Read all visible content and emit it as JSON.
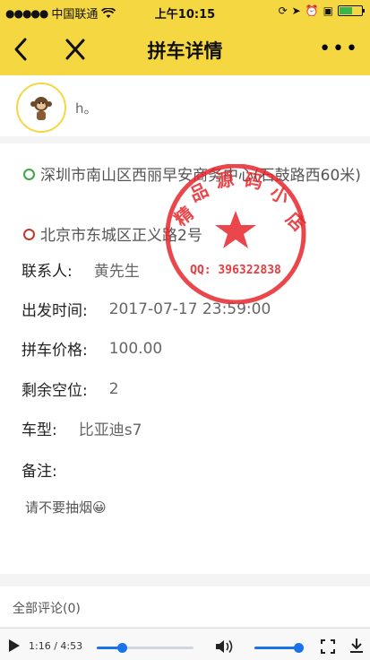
{
  "status_bar": {
    "carrier": "中国联通",
    "time": "上午10:15"
  },
  "nav": {
    "title": "拼车详情",
    "more": "•••"
  },
  "user": {
    "name": "h。"
  },
  "route": {
    "from": "深圳市南山区西丽早安商务中心(石鼓路西60米)",
    "to": "北京市东城区正义路2号",
    "from_color": "#3aa845",
    "to_color": "#c0392b"
  },
  "fields": {
    "contact_label": "联系人:",
    "contact_value": "黄先生",
    "depart_label": "出发时间:",
    "depart_value": "2017-07-17 23:59:00",
    "price_label": "拼车价格:",
    "price_value": "100.00",
    "seats_label": "剩余空位:",
    "seats_value": "2",
    "car_label": "车型:",
    "car_value": "比亚迪s7",
    "remark_label": "备注:",
    "remark_value": "请不要抽烟😀"
  },
  "watermark": {
    "chars": [
      "精",
      "品",
      "源",
      "码",
      "小",
      "店"
    ],
    "qq": "QQ: 396322838",
    "color": "#e8262b"
  },
  "comments": {
    "label": "全部评论(0)"
  },
  "video": {
    "current": "1:16",
    "total": "4:53",
    "progress": 0.26,
    "volume": 0.9
  },
  "colors": {
    "accent": "#f5d742",
    "player_blue": "#1a73e8"
  }
}
